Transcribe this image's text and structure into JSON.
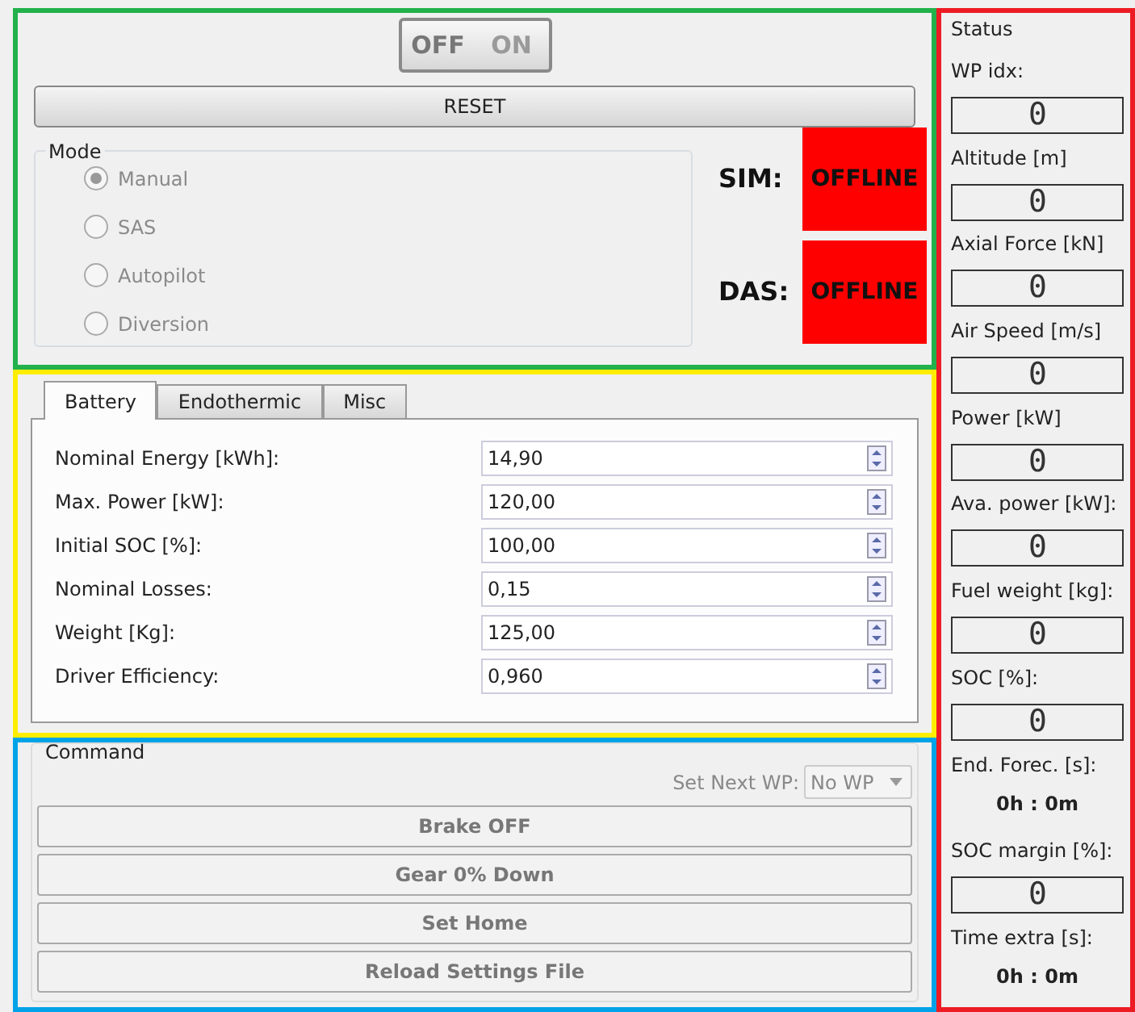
{
  "power_switch": {
    "off_label": "OFF",
    "on_label": "ON",
    "on": false
  },
  "reset_button": "RESET",
  "mode": {
    "title": "Mode",
    "options": [
      {
        "label": "Manual",
        "selected": true
      },
      {
        "label": "SAS",
        "selected": false
      },
      {
        "label": "Autopilot",
        "selected": false
      },
      {
        "label": "Diversion",
        "selected": false
      }
    ]
  },
  "connections": [
    {
      "label": "SIM:",
      "status": "OFFLINE",
      "color": "#ff0000"
    },
    {
      "label": "DAS:",
      "status": "OFFLINE",
      "color": "#ff0000"
    }
  ],
  "tabs": [
    {
      "label": "Battery",
      "selected": true
    },
    {
      "label": "Endothermic",
      "selected": false
    },
    {
      "label": "Misc",
      "selected": false
    }
  ],
  "battery_fields": [
    {
      "label": "Nominal Energy [kWh]:",
      "value": "14,90"
    },
    {
      "label": "Max. Power [kW]:",
      "value": "120,00"
    },
    {
      "label": "Initial SOC [%]:",
      "value": "100,00"
    },
    {
      "label": "Nominal Losses:",
      "value": "0,15"
    },
    {
      "label": "Weight [Kg]:",
      "value": "125,00"
    },
    {
      "label": "Driver Efficiency:",
      "value": "0,960"
    }
  ],
  "command": {
    "title": "Command",
    "next_wp_label": "Set Next WP:",
    "next_wp_value": "No WP",
    "buttons": [
      "Brake OFF",
      "Gear 0% Down",
      "Set Home",
      "Reload Settings File"
    ]
  },
  "status": {
    "title": "Status",
    "items": [
      {
        "label": "WP idx:",
        "kind": "lcd",
        "value": "0"
      },
      {
        "label": "Altitude [m]",
        "kind": "lcd",
        "value": "0"
      },
      {
        "label": "Axial Force [kN]",
        "kind": "lcd",
        "value": "0"
      },
      {
        "label": "Air Speed [m/s]",
        "kind": "lcd",
        "value": "0"
      },
      {
        "label": "Power [kW]",
        "kind": "lcd",
        "value": "0"
      },
      {
        "label": "Ava. power [kW]:",
        "kind": "lcd",
        "value": "0"
      },
      {
        "label": "Fuel weight [kg]:",
        "kind": "lcd",
        "value": "0"
      },
      {
        "label": "SOC [%]:",
        "kind": "lcd",
        "value": "0"
      },
      {
        "label": "End. Forec. [s]:",
        "kind": "time",
        "value": "0h : 0m"
      },
      {
        "label": "SOC margin [%]:",
        "kind": "lcd",
        "value": "0"
      },
      {
        "label": "Time extra [s]:",
        "kind": "time",
        "value": "0h : 0m"
      }
    ]
  }
}
